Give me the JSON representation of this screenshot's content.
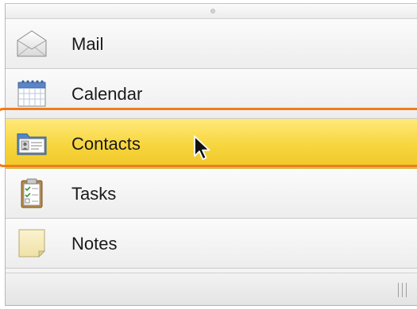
{
  "nav_items": [
    {
      "label": "Mail",
      "icon": "mail-envelope-icon",
      "selected": false
    },
    {
      "label": "Calendar",
      "icon": "calendar-icon",
      "selected": false
    },
    {
      "label": "Contacts",
      "icon": "contacts-card-icon",
      "selected": true
    },
    {
      "label": "Tasks",
      "icon": "tasks-clipboard-icon",
      "selected": false
    },
    {
      "label": "Notes",
      "icon": "notes-pad-icon",
      "selected": false
    }
  ],
  "colors": {
    "selected_highlight": "#f7d53d",
    "focus_ring": "#ef7d1c"
  }
}
